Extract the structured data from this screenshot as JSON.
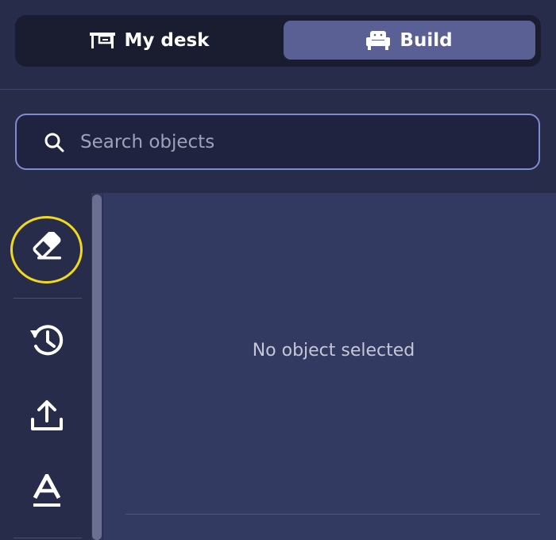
{
  "tabs": [
    {
      "label": "My desk",
      "icon": "desk-icon",
      "active": false
    },
    {
      "label": "Build",
      "icon": "sofa-icon",
      "active": true
    }
  ],
  "search": {
    "placeholder": "Search objects",
    "value": "",
    "icon": "search-icon"
  },
  "tools": [
    {
      "name": "eraser",
      "icon": "eraser-icon",
      "highlighted": true
    },
    {
      "name": "history",
      "icon": "history-icon"
    },
    {
      "name": "upload",
      "icon": "upload-icon"
    },
    {
      "name": "text",
      "icon": "text-icon"
    }
  ],
  "main": {
    "empty_message": "No object selected"
  },
  "colors": {
    "background": "#282c4b",
    "tab_bar": "#1a1d30",
    "active_tab": "#5a6093",
    "search_border": "#7f8bd1",
    "panel": "#333a62",
    "highlight_ring": "#f0da1a"
  }
}
